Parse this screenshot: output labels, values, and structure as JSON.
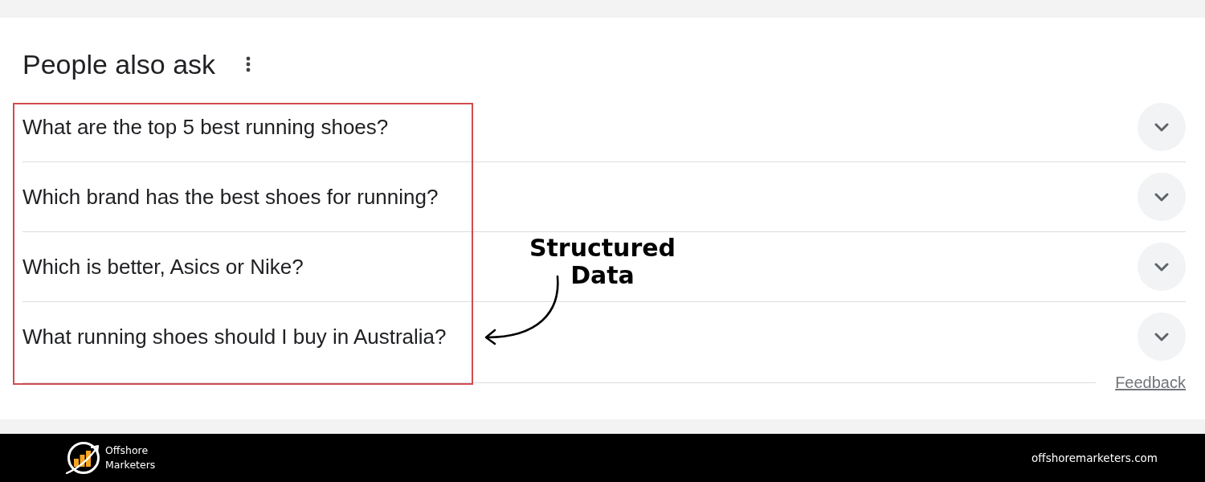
{
  "header": {
    "title": "People also ask"
  },
  "questions": [
    {
      "text": "What are the top 5 best running shoes?",
      "expanded": false
    },
    {
      "text": "Which brand has the best shoes for running?",
      "expanded": false
    },
    {
      "text": "Which is better, Asics or Nike?",
      "expanded": false
    },
    {
      "text": "What running shoes should I buy in Australia?",
      "expanded": false
    }
  ],
  "feedback": "Feedback",
  "annotation": {
    "label": "Structured Data"
  },
  "footer": {
    "brand": "Offshore Marketers",
    "url": "offshoremarketers.com"
  }
}
